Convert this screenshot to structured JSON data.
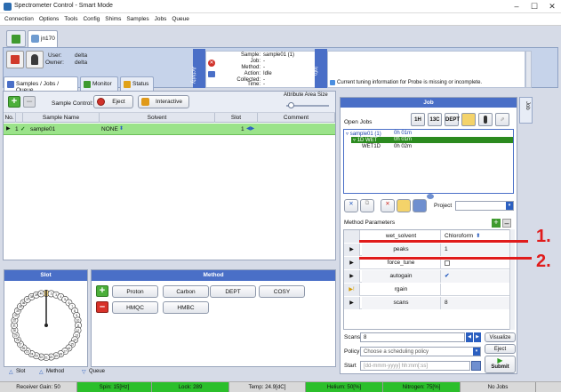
{
  "window": {
    "title": "Spectrometer Control - Smart Mode"
  },
  "menu": [
    "Connection",
    "Options",
    "Tools",
    "Config",
    "Shims",
    "Samples",
    "Jobs",
    "Queue"
  ],
  "user_tab": {
    "label": "jn170"
  },
  "user": {
    "user_label": "User:",
    "user_value": "delta",
    "owner_label": "Owner:",
    "owner_value": "delta"
  },
  "activity": {
    "bar_label": "Activity",
    "rows": [
      {
        "label": "Sample:",
        "value": "sample01  (1)"
      },
      {
        "label": "Job:",
        "value": "-"
      },
      {
        "label": "Method:",
        "value": "-"
      },
      {
        "label": "Action:",
        "value": "Idle"
      },
      {
        "label": "Collected:",
        "value": "-"
      },
      {
        "label": "Time:",
        "value": "-"
      }
    ]
  },
  "info": {
    "bar_label": "Info",
    "message": "Current tuning information for Probe is missing or incomplete."
  },
  "tabs": [
    "Samples / Jobs / Queue",
    "Monitor",
    "Status"
  ],
  "samples_toolbar": {
    "sample_control_label": "Sample Control:",
    "eject": "Eject",
    "interactive": "Interactive",
    "attr_label": "Attribute Area Size"
  },
  "table": {
    "headers": [
      "No.",
      "Sample Name",
      "Solvent",
      "Slot",
      "Comment"
    ],
    "rows": [
      {
        "no": "1",
        "name": "sample01",
        "solvent": "NONE",
        "slot": "1",
        "comment": ""
      }
    ]
  },
  "slot_panel": {
    "title": "Slot",
    "current": "1",
    "numbers": [
      "1",
      "2",
      "3",
      "4",
      "5",
      "6",
      "7",
      "8",
      "9",
      "10",
      "11",
      "12",
      "13",
      "14",
      "15",
      "16",
      "17",
      "18",
      "19",
      "20",
      "21",
      "22",
      "23",
      "24",
      "25",
      "26",
      "27",
      "28",
      "29",
      "30",
      "31",
      "32",
      "33",
      "34",
      "35",
      "36",
      "37",
      "38",
      "39",
      "40"
    ]
  },
  "method_panel": {
    "title": "Method",
    "buttons": [
      "Proton",
      "Carbon",
      "DEPT",
      "COSY",
      "HMQC",
      "HMBC"
    ]
  },
  "bottom_tabs": [
    "Slot",
    "Method",
    "Queue"
  ],
  "job_panel": {
    "title": "Job",
    "side_label": "Job",
    "open_jobs_label": "Open Jobs",
    "toolbar_icons": [
      "1H",
      "13C",
      "DEPT"
    ],
    "tree": [
      {
        "text": "sample01 (1)",
        "time": "0h 01m"
      },
      {
        "text": "1D WET",
        "time": "0h 01m"
      },
      {
        "text": "WET1D",
        "time": "0h 02m"
      }
    ],
    "project_label": "Project",
    "method_params_label": "Method Parameters",
    "params": [
      {
        "name": "wet_solvent",
        "value": "Chloroform"
      },
      {
        "name": "peaks",
        "value": "1"
      },
      {
        "name": "force_tune",
        "value": ""
      },
      {
        "name": "autogain",
        "value": ""
      },
      {
        "name": "rgain",
        "value": ""
      },
      {
        "name": "scans",
        "value": "8"
      }
    ],
    "scans_label": "Scans",
    "scans_value": "8",
    "policy_label": "Policy",
    "policy_placeholder": "Choose a scheduling policy",
    "start_label": "Start",
    "start_placeholder": "[dd-mmm-yyyy] hh:mm[:ss]",
    "visualize": "Visualize",
    "eject": "Eject",
    "submit": "Submit"
  },
  "annotations": {
    "one": "1.",
    "two": "2."
  },
  "colors": {
    "accent": "#4a6fc7",
    "green": "#2bbf2b",
    "row_green": "#9be38a",
    "annotation_red": "#e01b1b"
  },
  "status_bar": [
    "Receiver Gain: 50",
    "Spin: 15[Hz]",
    "Lock: 289",
    "Temp: 24.9[dC]",
    "Helium: 50[%]",
    "Nitrogen: 75[%]",
    "No Jobs"
  ]
}
